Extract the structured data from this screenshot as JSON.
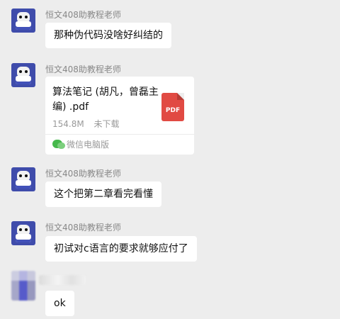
{
  "conversation": {
    "messages": [
      {
        "sender_name": "恒文408助教程老师",
        "text": "那种伪代码没啥好纠结的"
      },
      {
        "sender_name": "恒文408助教程老师",
        "file": {
          "title": "算法笔记 (胡凡，曾磊主编) .pdf",
          "size": "154.8M",
          "status": "未下载",
          "icon_label": "PDF",
          "source": "微信电脑版"
        }
      },
      {
        "sender_name": "恒文408助教程老师",
        "text": "这个把第二章看完看懂"
      },
      {
        "sender_name": "恒文408助教程老师",
        "text": "初试对c语言的要求就够应付了"
      },
      {
        "sender_name": "",
        "text": "ok"
      }
    ]
  }
}
